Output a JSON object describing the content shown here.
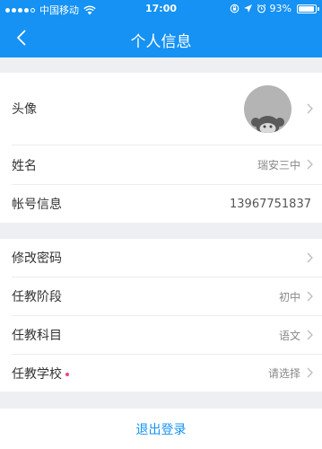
{
  "status_bar": {
    "carrier": "中国移动",
    "time": "17:00",
    "battery": "93%",
    "battery_level": 0.93,
    "signal_bars": 4,
    "icons": [
      "signal-dots-icon",
      "wifi-icon",
      "rotation-lock-icon",
      "location-arrow-icon",
      "alarm-icon",
      "battery-icon"
    ]
  },
  "navbar": {
    "title": "个人信息",
    "back_icon": "chevron-left-icon"
  },
  "profile": {
    "avatar_label": "头像",
    "name_label": "姓名",
    "name_value": "瑞安三中",
    "account_label": "帐号信息",
    "account_value": "13967751837"
  },
  "settings": {
    "password_label": "修改密码",
    "stage_label": "任教阶段",
    "stage_value": "初中",
    "subject_label": "任教科目",
    "subject_value": "语文",
    "school_label": "任教学校",
    "school_value": "请选择"
  },
  "logout": {
    "label": "退出登录"
  },
  "colors": {
    "primary": "#1592f3",
    "background": "#eeeff3",
    "required_dot": "#e8478f"
  }
}
